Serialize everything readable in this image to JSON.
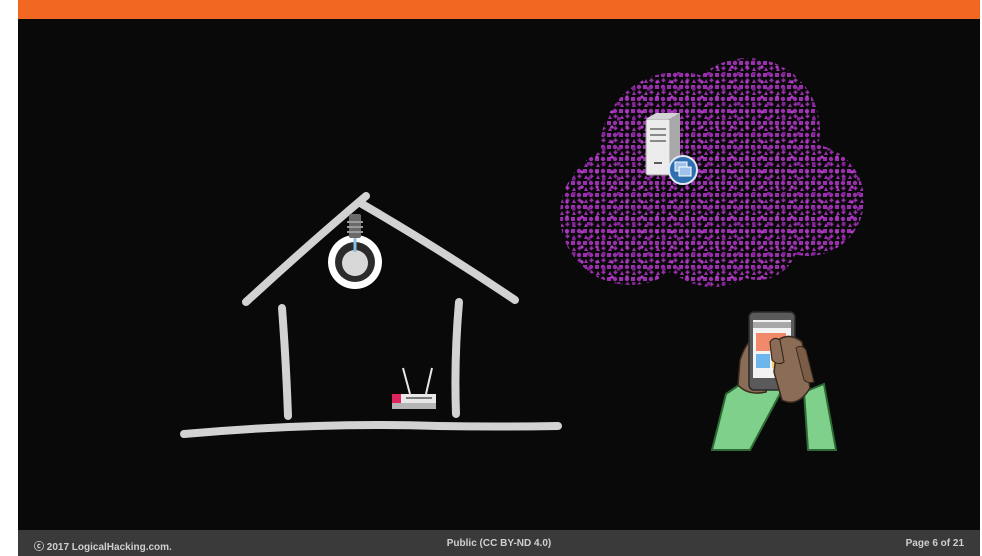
{
  "slide": {
    "accent_color": "#f26722",
    "background_color": "#090909",
    "cloud_color": "#9b2fae"
  },
  "illustration": {
    "icons": [
      "house-icon",
      "light-bulb-icon",
      "router-icon",
      "cloud-icon",
      "server-icon",
      "smartphone-icon"
    ]
  },
  "footer": {
    "copyright": "ⓒ 2017 LogicalHacking.com.",
    "license": "Public (CC BY-ND 4.0)",
    "page": "Page 6 of 21"
  }
}
